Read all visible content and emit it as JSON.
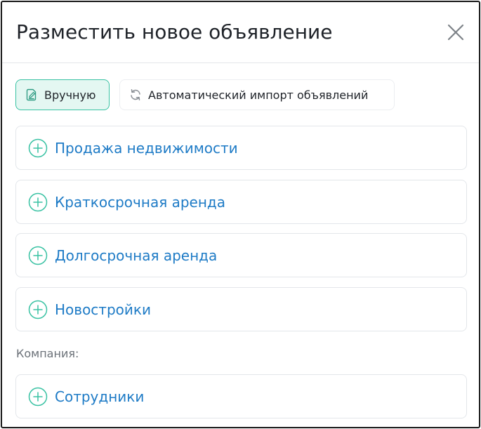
{
  "modal": {
    "title": "Разместить новое объявление",
    "close_icon": "close-icon"
  },
  "modes": [
    {
      "label": "Вручную",
      "icon": "edit-document-icon",
      "active": true
    },
    {
      "label": "Автоматический импорт объявлений",
      "icon": "refresh-icon",
      "active": false
    }
  ],
  "sections": [
    {
      "label": "Продажа недвижимости",
      "icon": "plus-circle-icon"
    },
    {
      "label": "Краткосрочная аренда",
      "icon": "plus-circle-icon"
    },
    {
      "label": "Долгосрочная аренда",
      "icon": "plus-circle-icon"
    },
    {
      "label": "Новостройки",
      "icon": "plus-circle-icon"
    }
  ],
  "company": {
    "label": "Компания:",
    "sections": [
      {
        "label": "Сотрудники",
        "icon": "plus-circle-icon"
      }
    ]
  },
  "colors": {
    "accent_teal": "#39c2a3",
    "active_bg": "#e4f7f2",
    "link_blue": "#1e7bc6",
    "border": "#e3e6ea"
  }
}
